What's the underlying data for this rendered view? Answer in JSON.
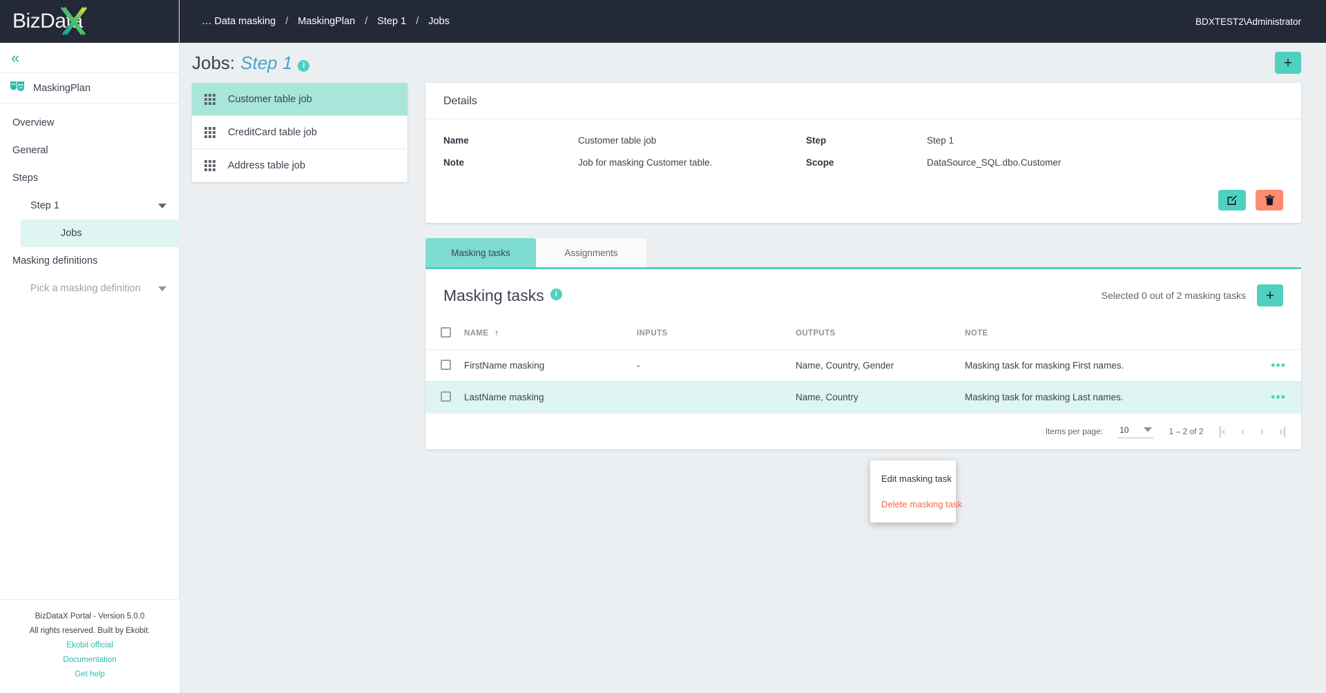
{
  "brand": {
    "name": "BizData",
    "accent_letter": "X",
    "accent_color": "#2bbbad"
  },
  "sidebar": {
    "collapse_icon": "chevron-double-left-icon",
    "plan": {
      "label": "MaskingPlan",
      "icon": "masks-icon"
    },
    "nav": [
      {
        "label": "Overview",
        "level": 0,
        "active": false
      },
      {
        "label": "General",
        "level": 0,
        "active": false
      },
      {
        "label": "Steps",
        "level": 0,
        "active": false
      },
      {
        "label": "Step 1",
        "level": 1,
        "active": false,
        "caret": true
      },
      {
        "label": "Jobs",
        "level": 2,
        "active": true
      },
      {
        "label": "Masking definitions",
        "level": 0,
        "active": false
      },
      {
        "label": "Pick a masking definition",
        "level": 1,
        "active": false,
        "caret": true,
        "placeholder": true
      }
    ],
    "footer": {
      "version": "BizDataX Portal - Version 5.0.0",
      "rights": "All rights reserved. Built by Ekobit.",
      "links": [
        "Ekobit official",
        "Documentation",
        "Get help"
      ]
    }
  },
  "topbar": {
    "breadcrumbs": [
      "… Data masking",
      "MaskingPlan",
      "Step 1",
      "Jobs"
    ],
    "separator": "/",
    "user": "BDXTEST2\\Administrator"
  },
  "page": {
    "title_prefix": "Jobs:",
    "title_value": "Step 1",
    "info_icon": "info-icon",
    "add_button_label": "+"
  },
  "jobs": [
    {
      "label": "Customer table job",
      "active": true
    },
    {
      "label": "CreditCard table job",
      "active": false
    },
    {
      "label": "Address table job",
      "active": false
    }
  ],
  "details": {
    "heading": "Details",
    "fields": [
      {
        "label": "Name",
        "value": "Customer table job"
      },
      {
        "label": "Note",
        "value": "Job for masking Customer table."
      }
    ],
    "fields_right": [
      {
        "label": "Step",
        "value": "Step 1"
      },
      {
        "label": "Scope",
        "value": "DataSource_SQL.dbo.Customer"
      }
    ],
    "edit_icon": "edit-pencil-icon",
    "delete_icon": "trash-icon"
  },
  "tabs": [
    {
      "label": "Masking tasks",
      "active": true
    },
    {
      "label": "Assignments",
      "active": false
    }
  ],
  "tasks": {
    "heading": "Masking tasks",
    "info_icon": "info-icon",
    "selection_text": "Selected 0 out of 2 masking tasks",
    "add_button_label": "+",
    "columns": [
      "NAME",
      "INPUTS",
      "OUTPUTS",
      "NOTE"
    ],
    "sort_column": "NAME",
    "sort_icon": "arrow-up-icon",
    "rows": [
      {
        "name": "FirstName masking",
        "inputs": "-",
        "outputs": "Name, Country, Gender",
        "note": "Masking task for masking First names.",
        "highlighted": false
      },
      {
        "name": "LastName masking",
        "inputs": "",
        "outputs": "Name, Country",
        "note": "Masking task for masking Last names.",
        "highlighted": true
      }
    ],
    "paginator": {
      "items_per_page_label": "Items per page:",
      "items_per_page_value": "10",
      "range": "1 – 2 of 2",
      "first_icon": "first-page-icon",
      "prev_icon": "prev-page-icon",
      "next_icon": "next-page-icon",
      "last_icon": "last-page-icon"
    }
  },
  "context_menu": {
    "items": [
      {
        "label": "Edit masking task",
        "danger": false
      },
      {
        "label": "Delete masking task",
        "danger": true
      }
    ]
  }
}
